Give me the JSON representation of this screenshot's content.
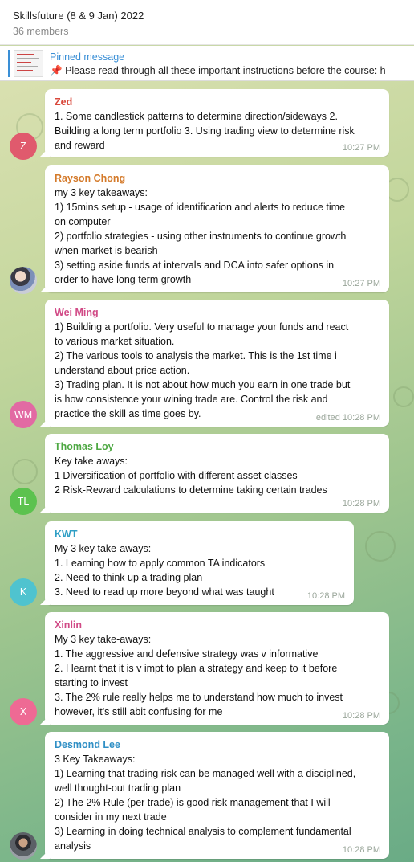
{
  "header": {
    "title": "Skillsfuture (8 & 9 Jan) 2022",
    "members": "36 members"
  },
  "pinned": {
    "label": "Pinned message",
    "icon": "📌",
    "text": "Please read through all these important instructions before the course:  h"
  },
  "messages": [
    {
      "sender": "Zed",
      "color": "#d9483b",
      "avatar_initials": "Z",
      "avatar_color": "#e05a6d",
      "lines": [
        "1. Some candlestick patterns to determine direction/sideways 2.",
        "Building a long term portfolio 3. Using trading view to determine risk",
        "and reward"
      ],
      "time": "10:27 PM"
    },
    {
      "sender": "Rayson Chong",
      "color": "#d47a2a",
      "avatar_initials": "",
      "avatar_color": "#6d6f7a",
      "lines": [
        "my 3 key takeaways:",
        "1) 15mins setup - usage of identification and alerts to reduce time",
        "on computer",
        "2) portfolio strategies - using other instruments to continue growth",
        "when market is bearish",
        "3) setting aside funds at intervals and DCA into safer options in",
        "order to have long term growth"
      ],
      "time": "10:27 PM"
    },
    {
      "sender": "Wei Ming",
      "color": "#d14a86",
      "avatar_initials": "WM",
      "avatar_color": "#e26aa3",
      "lines": [
        "1) Building a portfolio. Very useful to manage your funds and react",
        "to various market situation.",
        "2) The various tools to analysis the market. This is the 1st time i",
        "understand about price action.",
        "3) Trading plan. It is not about how much you earn in one trade but",
        "is how consistence your wining trade are. Control the risk and",
        "practice the skill as time goes by."
      ],
      "time": "edited 10:28 PM"
    },
    {
      "sender": "Thomas Loy",
      "color": "#4ea843",
      "avatar_initials": "TL",
      "avatar_color": "#5cc24f",
      "lines": [
        "Key take aways:",
        "1 Diversification of portfolio with different asset classes",
        "2 Risk-Reward calculations to determine taking certain trades"
      ],
      "time": "10:28 PM"
    },
    {
      "sender": "KWT",
      "color": "#2f9fc5",
      "avatar_initials": "K",
      "avatar_color": "#4fc3cf",
      "lines": [
        "My 3 key take-aways:",
        "1. Learning how to apply common TA indicators",
        "2. Need to think up a trading plan",
        "3. Need to read up more beyond what was taught"
      ],
      "time": "10:28 PM"
    },
    {
      "sender": "Xinlin",
      "color": "#d14a86",
      "avatar_initials": "X",
      "avatar_color": "#ee6a94",
      "lines": [
        "My 3 key take-aways:",
        "1. The aggressive and defensive strategy was v informative",
        "2. I learnt that it is v impt to plan a strategy and keep to it before",
        "starting to invest",
        "3. The 2% rule really helps me to understand how much to invest",
        "however, it's still abit confusing for me"
      ],
      "time": "10:28 PM"
    },
    {
      "sender": "Desmond Lee",
      "color": "#2f8fc5",
      "avatar_initials": "",
      "avatar_color": "#555a5e",
      "lines": [
        "3 Key Takeaways:",
        "1) Learning that trading risk can be managed well with a disciplined,",
        "well thought-out trading plan",
        "2) The 2% Rule (per trade) is good risk management that I will",
        "consider in my next trade",
        "3) Learning in doing technical analysis to complement fundamental",
        "analysis"
      ],
      "time": "10:28 PM"
    }
  ]
}
